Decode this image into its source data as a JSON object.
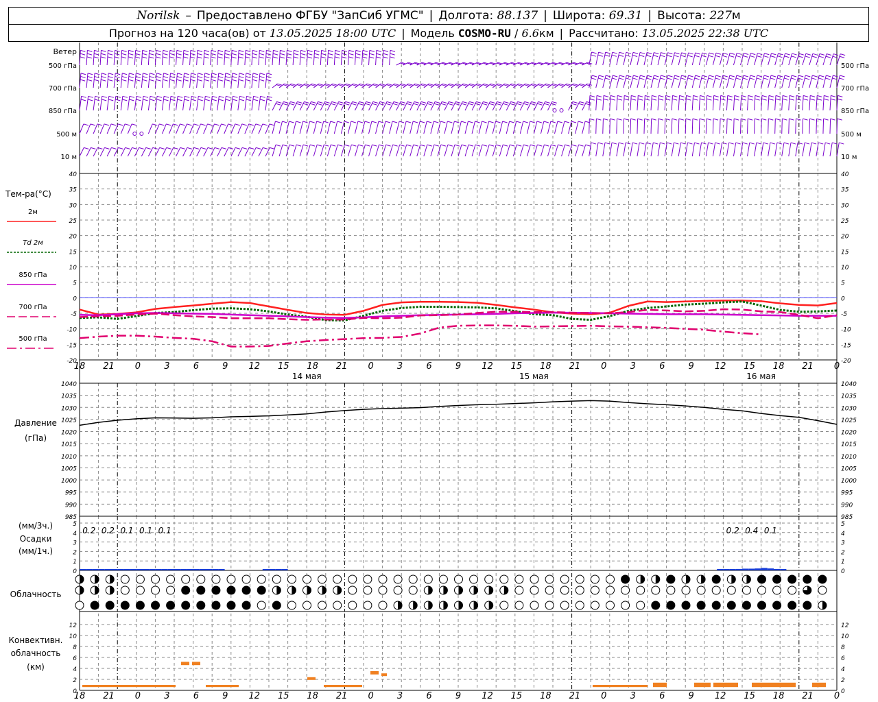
{
  "header": {
    "station": "Norilsk",
    "dash": "–",
    "provider": "Предоставлено ФГБУ \"ЗапСиб УГМС\"",
    "lon_label": "Долгота:",
    "lon_value": "88.137",
    "lat_label": "Широта:",
    "lat_value": "69.31",
    "alt_label": "Высота:",
    "alt_value": "227",
    "alt_unit": "м",
    "forecast_label": "Прогноз на 120 часа(ов) от",
    "forecast_from": "13.05.2025 18:00 UTC",
    "model_label": "Модель",
    "model_name": "COSMO-RU",
    "model_res": "6.6",
    "model_res_unit": "км",
    "calc_label": "Рассчитано:",
    "calc_time": "13.05.2025 22:38 UTC"
  },
  "wind": {
    "title": "Ветер",
    "levels": [
      "500 гПа",
      "700 гПа",
      "850 гПа",
      "500 м",
      "10 м"
    ],
    "color": "#7a00cc"
  },
  "temp_panel": {
    "title": "Тем-ра(°С)",
    "legend": [
      {
        "label": "2м",
        "color": "#ff2020",
        "dash": "solid"
      },
      {
        "label": "Td 2м",
        "color": "#006600",
        "dash": "dotted"
      },
      {
        "label": "850 гПа",
        "color": "#cc00cc",
        "dash": "solid"
      },
      {
        "label": "700 гПа",
        "color": "#e0006e",
        "dash": "dash"
      },
      {
        "label": "500 гПа",
        "color": "#e0006e",
        "dash": "dashdot"
      }
    ],
    "y_ticks": [
      40,
      35,
      30,
      25,
      20,
      15,
      10,
      5,
      0,
      -5,
      -10,
      -15,
      -20
    ]
  },
  "x_hours": [
    "18",
    "21",
    "0",
    "3",
    "6",
    "9",
    "12",
    "15",
    "18",
    "21",
    "0",
    "3",
    "6",
    "9",
    "12",
    "15",
    "18",
    "21",
    "0",
    "3",
    "6",
    "9",
    "12",
    "15",
    "18",
    "21",
    "0"
  ],
  "dates": [
    "14 мая",
    "15 мая",
    "16 мая"
  ],
  "pressure_panel": {
    "title": "Давление",
    "unit": "(гПа)",
    "y_ticks": [
      1040,
      1035,
      1030,
      1025,
      1020,
      1015,
      1010,
      1005,
      1000,
      995,
      990,
      985
    ]
  },
  "precip_panel": {
    "unit_top": "(мм/3ч.)",
    "title": "Осадки",
    "unit_bottom": "(мм/1ч.)",
    "y_ticks": [
      5,
      4,
      3,
      2,
      1,
      0
    ],
    "labels": [
      {
        "hour": 1.5,
        "text": "0.2"
      },
      {
        "hour": 4.5,
        "text": "0.2"
      },
      {
        "hour": 7.5,
        "text": "0.1"
      },
      {
        "hour": 10.5,
        "text": "0.1"
      },
      {
        "hour": 13.5,
        "text": "0.1"
      },
      {
        "hour": 103.5,
        "text": "0.2"
      },
      {
        "hour": 106.5,
        "text": "0.4"
      },
      {
        "hour": 109.5,
        "text": "0.1"
      }
    ]
  },
  "cloud_panel": {
    "title": "Облачность"
  },
  "conv_panel": {
    "title_1": "Конвективн.",
    "title_2": "облачность",
    "unit": "(км)",
    "y_ticks": [
      12,
      10,
      8,
      6,
      4,
      2,
      0
    ]
  },
  "chart_data": [
    {
      "type": "line",
      "title": "Тем-ра(°С)",
      "x_hours_from_start": [
        0,
        3,
        6,
        9,
        12,
        15,
        18,
        21,
        24,
        27,
        30,
        33,
        36,
        39,
        42,
        45,
        48,
        51,
        54,
        57,
        60,
        63,
        66,
        69,
        72,
        75,
        78,
        81,
        84,
        87,
        90,
        93,
        96,
        99,
        102,
        105,
        108,
        111,
        114,
        117,
        120
      ],
      "ylim": [
        -20,
        40
      ],
      "series": [
        {
          "name": "2м",
          "values": [
            -3.8,
            -5.4,
            -5.2,
            -4.7,
            -3.6,
            -3.0,
            -2.5,
            -1.9,
            -1.4,
            -1.7,
            -2.8,
            -3.9,
            -4.9,
            -5.4,
            -5.5,
            -4.2,
            -2.3,
            -1.5,
            -1.3,
            -1.3,
            -1.4,
            -1.6,
            -2.3,
            -3.1,
            -3.8,
            -4.7,
            -5.1,
            -5.3,
            -4.8,
            -2.6,
            -1.2,
            -1.4,
            -1.2,
            -1.0,
            -0.9,
            -0.9,
            -1.1,
            -1.8,
            -2.3,
            -2.5,
            -1.7
          ]
        },
        {
          "name": "Td 2м",
          "values": [
            -6.5,
            -6.3,
            -6.8,
            -5.9,
            -4.9,
            -4.6,
            -4.0,
            -3.5,
            -3.4,
            -3.7,
            -4.4,
            -5.4,
            -6.1,
            -7.2,
            -7.3,
            -5.8,
            -4.2,
            -3.3,
            -2.9,
            -2.9,
            -3.0,
            -3.1,
            -3.4,
            -4.3,
            -5.3,
            -5.6,
            -6.8,
            -7.1,
            -5.9,
            -4.2,
            -3.3,
            -2.8,
            -2.2,
            -1.9,
            -1.5,
            -1.2,
            -2.5,
            -3.9,
            -4.5,
            -4.4,
            -4.1
          ]
        },
        {
          "name": "850 гПа",
          "values": [
            -5.5,
            -5.6,
            -5.3,
            -5.0,
            -4.9,
            -5.0,
            -5.1,
            -5.2,
            -5.4,
            -5.6,
            -5.8,
            -6.0,
            -6.2,
            -6.4,
            -6.5,
            -6.3,
            -6.0,
            -5.8,
            -5.6,
            -5.5,
            -5.4,
            -5.3,
            -5.2,
            -5.0,
            -4.9,
            -4.8,
            -4.8,
            -4.9,
            -5.0,
            -5.1,
            -5.2,
            -5.3,
            -5.3,
            -5.3,
            -5.4,
            -5.5,
            -5.6,
            -5.7,
            -5.8,
            -5.8,
            -5.8
          ]
        },
        {
          "name": "700 гПа",
          "values": [
            -6.2,
            -6.0,
            -5.8,
            -5.4,
            -5.1,
            -5.6,
            -6.0,
            -6.2,
            -6.6,
            -6.6,
            -6.6,
            -6.9,
            -7.1,
            -7.0,
            -7.0,
            -6.5,
            -6.6,
            -6.4,
            -5.7,
            -5.6,
            -5.4,
            -4.9,
            -4.5,
            -4.5,
            -4.6,
            -4.6,
            -4.8,
            -4.9,
            -5.0,
            -4.6,
            -3.9,
            -4.1,
            -4.4,
            -4.2,
            -3.7,
            -3.8,
            -4.4,
            -4.6,
            -5.5,
            -6.6,
            -5.6
          ]
        },
        {
          "name": "500 гПа",
          "values": [
            -13.0,
            -12.5,
            -12.2,
            -12.2,
            -12.5,
            -12.9,
            -13.2,
            -14.0,
            -15.7,
            -15.7,
            -15.5,
            -14.7,
            -14.0,
            -13.6,
            -13.3,
            -13.0,
            -12.9,
            -12.6,
            -11.5,
            -9.6,
            -9.0,
            -8.9,
            -8.9,
            -9.0,
            -9.3,
            -9.2,
            -9.1,
            -9.0,
            -9.2,
            -9.3,
            -9.5,
            -9.7,
            -10.0,
            -10.3,
            -10.9,
            -11.4,
            -11.8
          ]
        }
      ]
    },
    {
      "type": "line",
      "title": "Давление",
      "ylabel": "(гПа)",
      "ylim": [
        985,
        1040
      ],
      "x_hours_from_start": [
        0,
        3,
        6,
        9,
        12,
        15,
        18,
        21,
        24,
        27,
        30,
        33,
        36,
        39,
        42,
        45,
        48,
        51,
        54,
        57,
        60,
        63,
        66,
        69,
        72,
        75,
        78,
        81,
        84,
        87,
        90,
        93,
        96,
        99,
        102,
        105,
        108,
        111,
        114,
        117,
        120
      ],
      "series": [
        {
          "name": "Давление",
          "values": [
            1022.6,
            1023.8,
            1024.7,
            1025.3,
            1025.7,
            1025.6,
            1025.5,
            1025.7,
            1026.1,
            1026.3,
            1026.5,
            1026.9,
            1027.3,
            1028.1,
            1028.7,
            1029.2,
            1029.5,
            1029.7,
            1029.9,
            1030.4,
            1030.8,
            1031.1,
            1031.3,
            1031.6,
            1031.9,
            1032.3,
            1032.6,
            1032.8,
            1032.6,
            1032.0,
            1031.5,
            1031.1,
            1030.6,
            1030.0,
            1029.2,
            1028.6,
            1027.5,
            1026.6,
            1025.9,
            1024.5,
            1023.0
          ]
        }
      ]
    },
    {
      "type": "bar",
      "title": "Осадки",
      "ylabel": "(мм/1ч.)",
      "ylim": [
        0,
        5
      ],
      "x_hours_from_start": [
        1,
        2,
        3,
        4,
        5,
        6,
        7,
        8,
        9,
        10,
        11,
        12,
        13,
        14,
        15,
        16,
        17,
        18,
        19,
        20,
        21,
        22,
        23,
        24,
        25,
        26,
        27,
        28,
        29,
        30,
        31,
        32,
        33,
        102,
        103,
        104,
        105,
        106,
        107,
        108,
        109,
        110,
        111,
        112
      ],
      "values": [
        0.05,
        0.08,
        0.1,
        0.12,
        0.1,
        0.08,
        0.08,
        0.07,
        0.06,
        0.05,
        0.05,
        0.05,
        0.05,
        0.04,
        0.04,
        0.04,
        0.03,
        0.03,
        0.03,
        0.03,
        0.03,
        0.03,
        0.02,
        0.0,
        0.0,
        0.0,
        0.0,
        0.0,
        0.0,
        0.03,
        0.04,
        0.04,
        0.03,
        0.05,
        0.08,
        0.1,
        0.15,
        0.18,
        0.18,
        0.2,
        0.25,
        0.2,
        0.15,
        0.1
      ]
    },
    {
      "type": "bar",
      "title": "Конвективн. облачность",
      "ylabel": "(км)",
      "ylim": [
        0,
        13
      ],
      "segments": [
        {
          "from": 1,
          "to": 35,
          "base": 0.6,
          "top": 1.0
        },
        {
          "from": 37,
          "to": 40,
          "base": 4.6,
          "top": 5.2
        },
        {
          "from": 41,
          "to": 44,
          "base": 4.6,
          "top": 5.2
        },
        {
          "from": 46,
          "to": 58,
          "base": 0.6,
          "top": 1.0
        },
        {
          "from": 83,
          "to": 86,
          "base": 1.9,
          "top": 2.4
        },
        {
          "from": 89,
          "to": 103,
          "base": 0.6,
          "top": 1.0
        },
        {
          "from": 106,
          "to": 109,
          "base": 2.9,
          "top": 3.5
        },
        {
          "from": 110,
          "to": 112,
          "base": 2.6,
          "top": 3.1
        },
        {
          "from": 187,
          "to": 207,
          "base": 0.6,
          "top": 1.0
        },
        {
          "from": 209,
          "to": 214,
          "base": 0.6,
          "top": 1.4
        },
        {
          "from": 224,
          "to": 230,
          "base": 0.6,
          "top": 1.4
        },
        {
          "from": 231,
          "to": 240,
          "base": 0.6,
          "top": 1.4
        },
        {
          "from": 245,
          "to": 261,
          "base": 0.6,
          "top": 1.4
        },
        {
          "from": 267,
          "to": 272,
          "base": 0.6,
          "top": 1.4
        }
      ]
    }
  ]
}
